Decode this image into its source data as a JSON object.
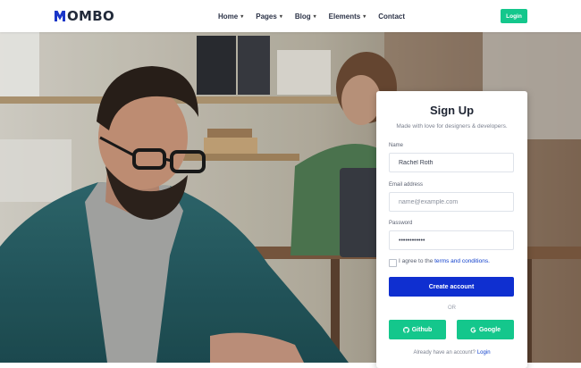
{
  "brand": {
    "name": "OMBO",
    "accent": "#1a36c8"
  },
  "nav": {
    "items": [
      {
        "label": "Home",
        "chevron": "chevron-down-icon"
      },
      {
        "label": "Pages",
        "chevron": "chevron-down-icon"
      },
      {
        "label": "Blog",
        "chevron": "chevron-down-icon"
      },
      {
        "label": "Elements",
        "chevron": "chevron-down-icon"
      },
      {
        "label": "Contact"
      }
    ],
    "login_label": "Login"
  },
  "signup": {
    "title": "Sign Up",
    "subtitle": "Made with love for designers & developers.",
    "name_label": "Name",
    "name_value": "Rachel Roth",
    "email_label": "Email address",
    "email_placeholder": "name@example.com",
    "password_label": "Password",
    "password_value": "••••••••••••",
    "agree_text": "I agree to the",
    "terms_link": "terms and conditions.",
    "submit_label": "Create account",
    "or_text": "OR",
    "github_label": "Github",
    "google_label": "Google",
    "already_text": "Already have an account?",
    "login_link": "Login"
  },
  "colors": {
    "primary": "#0f2fd0",
    "success": "#14c78c",
    "link": "#1140cc"
  }
}
